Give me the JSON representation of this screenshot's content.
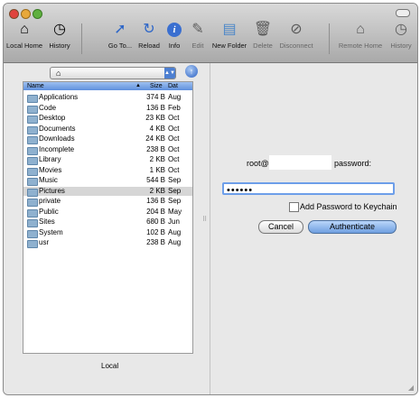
{
  "toolbar": {
    "local_home": "Local Home",
    "history_left": "History",
    "go_to": "Go To...",
    "reload": "Reload",
    "info": "Info",
    "edit": "Edit",
    "new_folder": "New Folder",
    "delete": "Delete",
    "disconnect": "Disconnect",
    "remote_home": "Remote Home",
    "history_right": "History"
  },
  "local": {
    "columns": {
      "name": "Name",
      "size": "Size",
      "date": "Dat"
    },
    "files": [
      {
        "name": "Applications",
        "size": "374 B",
        "date": "Aug"
      },
      {
        "name": "Code",
        "size": "136 B",
        "date": "Feb"
      },
      {
        "name": "Desktop",
        "size": "23 KB",
        "date": "Oct"
      },
      {
        "name": "Documents",
        "size": "4 KB",
        "date": "Oct"
      },
      {
        "name": "Downloads",
        "size": "24 KB",
        "date": "Oct"
      },
      {
        "name": "Incomplete",
        "size": "238 B",
        "date": "Oct"
      },
      {
        "name": "Library",
        "size": "2 KB",
        "date": "Oct"
      },
      {
        "name": "Movies",
        "size": "1 KB",
        "date": "Oct"
      },
      {
        "name": "Music",
        "size": "544 B",
        "date": "Sep"
      },
      {
        "name": "Pictures",
        "size": "2 KB",
        "date": "Sep"
      },
      {
        "name": "private",
        "size": "136 B",
        "date": "Sep"
      },
      {
        "name": "Public",
        "size": "204 B",
        "date": "May"
      },
      {
        "name": "Sites",
        "size": "680 B",
        "date": "Jun"
      },
      {
        "name": "System",
        "size": "102 B",
        "date": "Aug"
      },
      {
        "name": "usr",
        "size": "238 B",
        "date": "Aug"
      }
    ],
    "selected_index": 9,
    "label": "Local"
  },
  "auth": {
    "user_prefix": "root@",
    "host": "",
    "password_label": "password:",
    "password_value": "••••••",
    "add_keychain_label": "Add Password to Keychain",
    "add_keychain_checked": false,
    "cancel_label": "Cancel",
    "authenticate_label": "Authenticate"
  },
  "colors": {
    "accent": "#6d9ee9",
    "header_blue": "#5e90dd",
    "selection": "#d6d6d6"
  }
}
